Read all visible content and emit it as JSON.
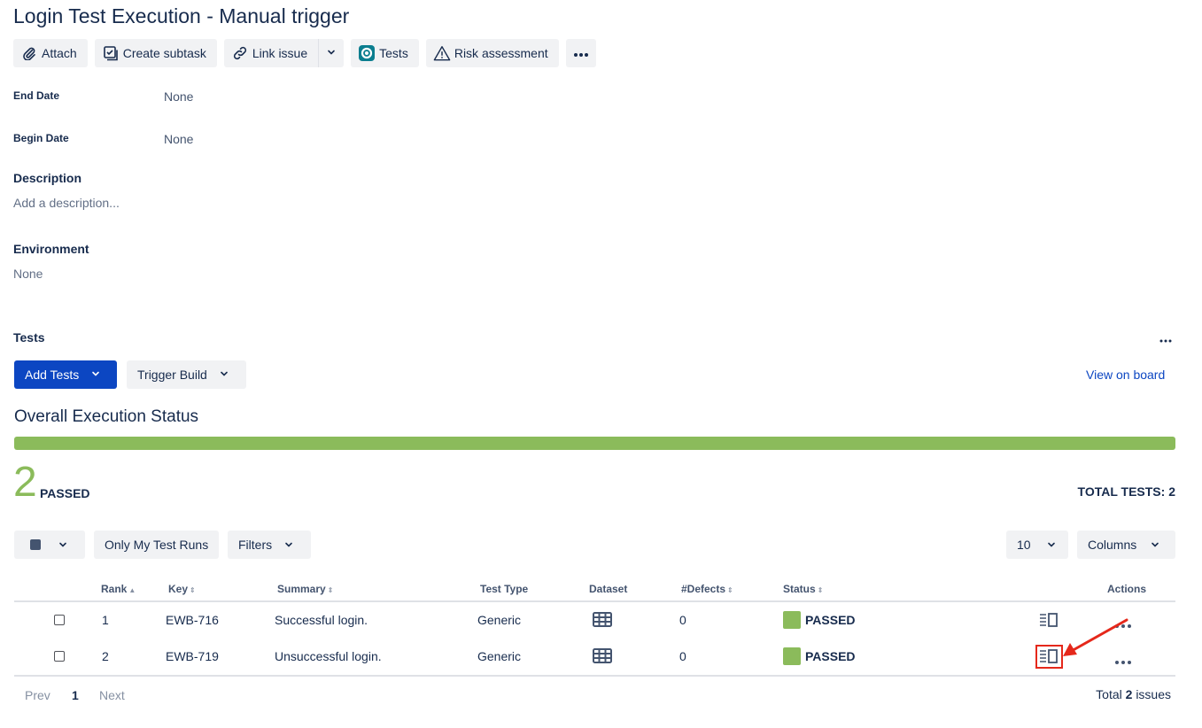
{
  "issue": {
    "title": "Login Test Execution - Manual trigger"
  },
  "toolbar": {
    "attach": "Attach",
    "create_subtask": "Create subtask",
    "link_issue": "Link issue",
    "tests": "Tests",
    "risk_assessment": "Risk assessment"
  },
  "fields": {
    "end_date_label": "End Date",
    "end_date_value": "None",
    "begin_date_label": "Begin Date",
    "begin_date_value": "None",
    "description_label": "Description",
    "description_placeholder": "Add a description...",
    "environment_label": "Environment",
    "environment_value": "None"
  },
  "tests_panel": {
    "heading": "Tests",
    "add_tests": "Add Tests",
    "trigger_build": "Trigger Build",
    "view_on_board": "View on board",
    "overall_status_heading": "Overall Execution Status",
    "passed_count": "2",
    "passed_label": "PASSED",
    "passed_fraction": 1.0,
    "total_tests": "TOTAL TESTS: 2",
    "only_my_test_runs": "Only My Test Runs",
    "filters": "Filters",
    "page_size": "10",
    "columns": "Columns"
  },
  "table": {
    "headers": {
      "rank": "Rank",
      "key": "Key",
      "summary": "Summary",
      "test_type": "Test Type",
      "dataset": "Dataset",
      "defects": "#Defects",
      "status": "Status",
      "actions": "Actions"
    },
    "rows": [
      {
        "rank": "1",
        "key": "EWB-716",
        "summary": "Successful login.",
        "test_type": "Generic",
        "defects": "0",
        "status": "PASSED"
      },
      {
        "rank": "2",
        "key": "EWB-719",
        "summary": "Unsuccessful login.",
        "test_type": "Generic",
        "defects": "0",
        "status": "PASSED"
      }
    ]
  },
  "pagination": {
    "prev": "Prev",
    "current_page": "1",
    "next": "Next",
    "total_prefix": "Total",
    "total_count": "2",
    "total_suffix": "issues"
  },
  "colors": {
    "passed_green": "#8bbb5b",
    "primary_blue": "#0c46c2",
    "highlight_red": "#e5281b"
  }
}
